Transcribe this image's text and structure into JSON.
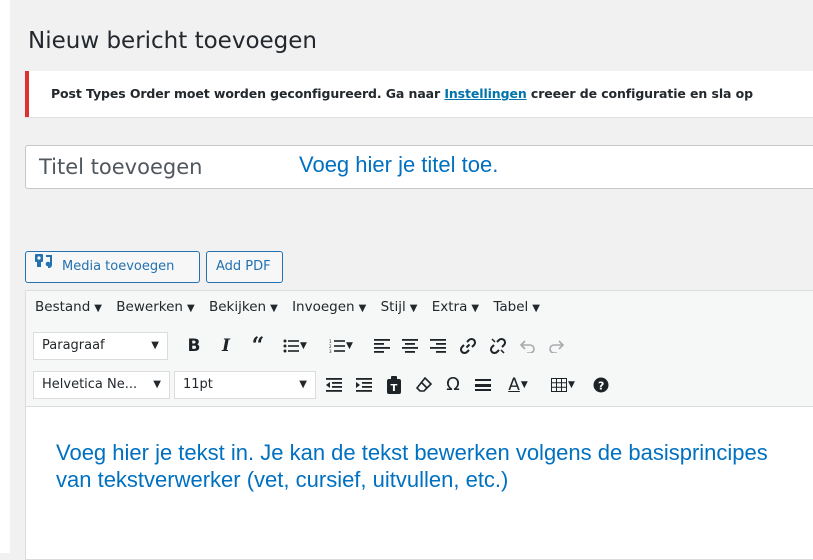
{
  "page": {
    "title": "Nieuw bericht toevoegen"
  },
  "notice": {
    "text_before": "Post Types Order moet worden geconfigureerd. Ga naar ",
    "link_text": "Instellingen",
    "text_after": " creeer de configuratie en sla op",
    "accent_color": "#dc3232"
  },
  "title_field": {
    "placeholder": "Titel toevoegen",
    "hint": "Voeg hier je titel toe."
  },
  "media_buttons": {
    "add_media": "Media toevoegen",
    "add_pdf": "Add PDF"
  },
  "menubar": {
    "items": [
      "Bestand",
      "Bewerken",
      "Bekijken",
      "Invoegen",
      "Stijl",
      "Extra",
      "Tabel"
    ]
  },
  "toolbar": {
    "format_select": "Paragraaf",
    "font_family_select": "Helvetica Ne...",
    "font_size_select": "11pt",
    "row1_icons": [
      "bold-icon",
      "italic-icon",
      "blockquote-icon",
      "bullet-list-icon",
      "numbered-list-icon",
      "align-left-icon",
      "align-center-icon",
      "align-right-icon",
      "link-icon",
      "unlink-icon",
      "undo-icon",
      "redo-icon"
    ],
    "row2_icons": [
      "outdent-icon",
      "indent-icon",
      "paste-text-icon",
      "clear-formatting-icon",
      "special-character-icon",
      "horizontal-line-icon",
      "text-color-icon",
      "table-icon",
      "help-icon"
    ]
  },
  "editor": {
    "content": "Voeg hier je tekst in. Je kan de tekst bewerken volgens de basisprincipes van tekstverwerker (vet, cursief, uitvullen, etc.)",
    "text_color": "#0070c0"
  }
}
